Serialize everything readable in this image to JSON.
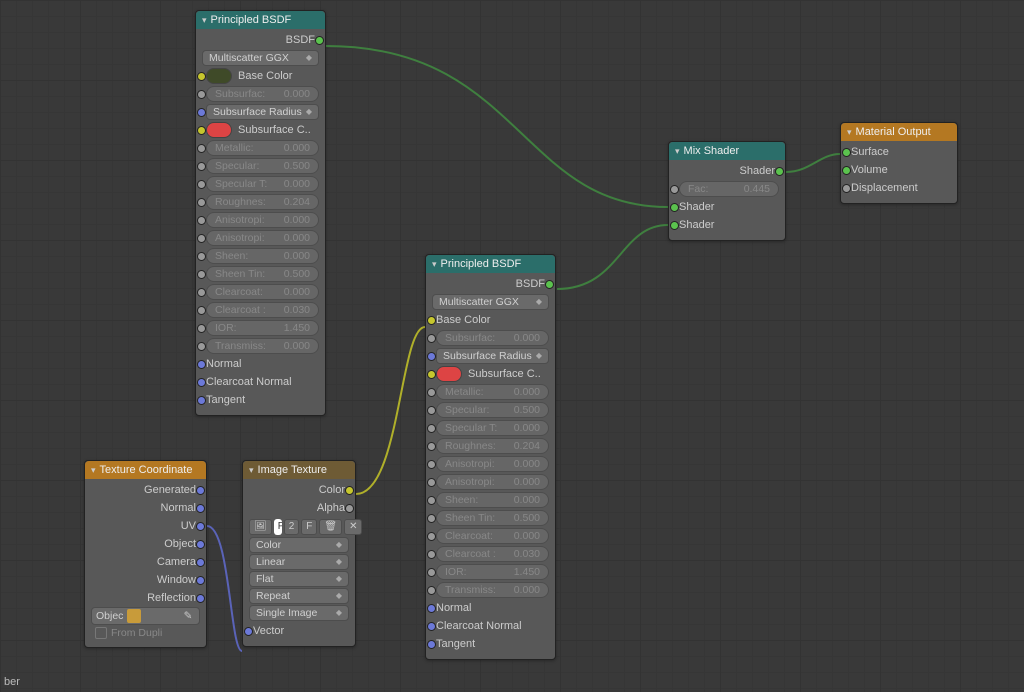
{
  "nodes": {
    "principled_a": {
      "title": "Principled BSDF",
      "output": "BSDF",
      "distribution": "Multiscatter GGX",
      "inputs": [
        {
          "label": "Base Color",
          "swatch": "olive",
          "socket": "color"
        },
        {
          "label": "Subsurfac:",
          "value": "0.000",
          "socket": "value",
          "disabled": true
        },
        {
          "label": "Subsurface Radius",
          "socket": "vector",
          "dropdown": true
        },
        {
          "label": "Subsurface C..",
          "swatch": "red",
          "socket": "color"
        },
        {
          "label": "Metallic:",
          "value": "0.000",
          "socket": "value",
          "disabled": true
        },
        {
          "label": "Specular:",
          "value": "0.500",
          "socket": "value",
          "disabled": true
        },
        {
          "label": "Specular T:",
          "value": "0.000",
          "socket": "value",
          "disabled": true
        },
        {
          "label": "Roughnes:",
          "value": "0.204",
          "socket": "value",
          "disabled": true
        },
        {
          "label": "Anisotropi:",
          "value": "0.000",
          "socket": "value",
          "disabled": true
        },
        {
          "label": "Anisotropi:",
          "value": "0.000",
          "socket": "value",
          "disabled": true
        },
        {
          "label": "Sheen:",
          "value": "0.000",
          "socket": "value",
          "disabled": true
        },
        {
          "label": "Sheen Tin:",
          "value": "0.500",
          "socket": "value",
          "disabled": true
        },
        {
          "label": "Clearcoat:",
          "value": "0.000",
          "socket": "value",
          "disabled": true
        },
        {
          "label": "Clearcoat :",
          "value": "0.030",
          "socket": "value",
          "disabled": true
        },
        {
          "label": "IOR:",
          "value": "1.450",
          "socket": "value",
          "disabled": true
        },
        {
          "label": "Transmiss:",
          "value": "0.000",
          "socket": "value",
          "disabled": true
        },
        {
          "label": "Normal",
          "socket": "vector"
        },
        {
          "label": "Clearcoat Normal",
          "socket": "vector"
        },
        {
          "label": "Tangent",
          "socket": "vector"
        }
      ]
    },
    "principled_b": {
      "title": "Principled BSDF",
      "output": "BSDF",
      "distribution": "Multiscatter GGX",
      "inputs": [
        {
          "label": "Base Color",
          "socket": "color",
          "plain": true
        },
        {
          "label": "Subsurfac:",
          "value": "0.000",
          "socket": "value",
          "disabled": true
        },
        {
          "label": "Subsurface Radius",
          "socket": "vector",
          "dropdown": true
        },
        {
          "label": "Subsurface C..",
          "swatch": "red",
          "socket": "color"
        },
        {
          "label": "Metallic:",
          "value": "0.000",
          "socket": "value",
          "disabled": true
        },
        {
          "label": "Specular:",
          "value": "0.500",
          "socket": "value",
          "disabled": true
        },
        {
          "label": "Specular T:",
          "value": "0.000",
          "socket": "value",
          "disabled": true
        },
        {
          "label": "Roughnes:",
          "value": "0.204",
          "socket": "value",
          "disabled": true
        },
        {
          "label": "Anisotropi:",
          "value": "0.000",
          "socket": "value",
          "disabled": true
        },
        {
          "label": "Anisotropi:",
          "value": "0.000",
          "socket": "value",
          "disabled": true
        },
        {
          "label": "Sheen:",
          "value": "0.000",
          "socket": "value",
          "disabled": true
        },
        {
          "label": "Sheen Tin:",
          "value": "0.500",
          "socket": "value",
          "disabled": true
        },
        {
          "label": "Clearcoat:",
          "value": "0.000",
          "socket": "value",
          "disabled": true
        },
        {
          "label": "Clearcoat :",
          "value": "0.030",
          "socket": "value",
          "disabled": true
        },
        {
          "label": "IOR:",
          "value": "1.450",
          "socket": "value",
          "disabled": true
        },
        {
          "label": "Transmiss:",
          "value": "0.000",
          "socket": "value",
          "disabled": true
        },
        {
          "label": "Normal",
          "socket": "vector"
        },
        {
          "label": "Clearcoat Normal",
          "socket": "vector"
        },
        {
          "label": "Tangent",
          "socket": "vector"
        }
      ]
    },
    "tex_coord": {
      "title": "Texture Coordinate",
      "outputs": [
        "Generated",
        "Normal",
        "UV",
        "Object",
        "Camera",
        "Window",
        "Reflection"
      ],
      "object_label": "Objec",
      "from_dupli": "From Dupli"
    },
    "image_tex": {
      "title": "Image Texture",
      "outputs": [
        "Color",
        "Alpha"
      ],
      "image_name": "Pho",
      "image_users": "2",
      "image_fake": "F",
      "dropdowns": [
        "Color",
        "Linear",
        "Flat",
        "Repeat",
        "Single Image"
      ],
      "vector_in": "Vector"
    },
    "mix_shader": {
      "title": "Mix Shader",
      "output": "Shader",
      "fac_label": "Fac:",
      "fac_value": "0.445",
      "shader_in1": "Shader",
      "shader_in2": "Shader"
    },
    "mat_out": {
      "title": "Material Output",
      "inputs": [
        "Surface",
        "Volume",
        "Displacement"
      ]
    }
  },
  "corner_note": "ber"
}
